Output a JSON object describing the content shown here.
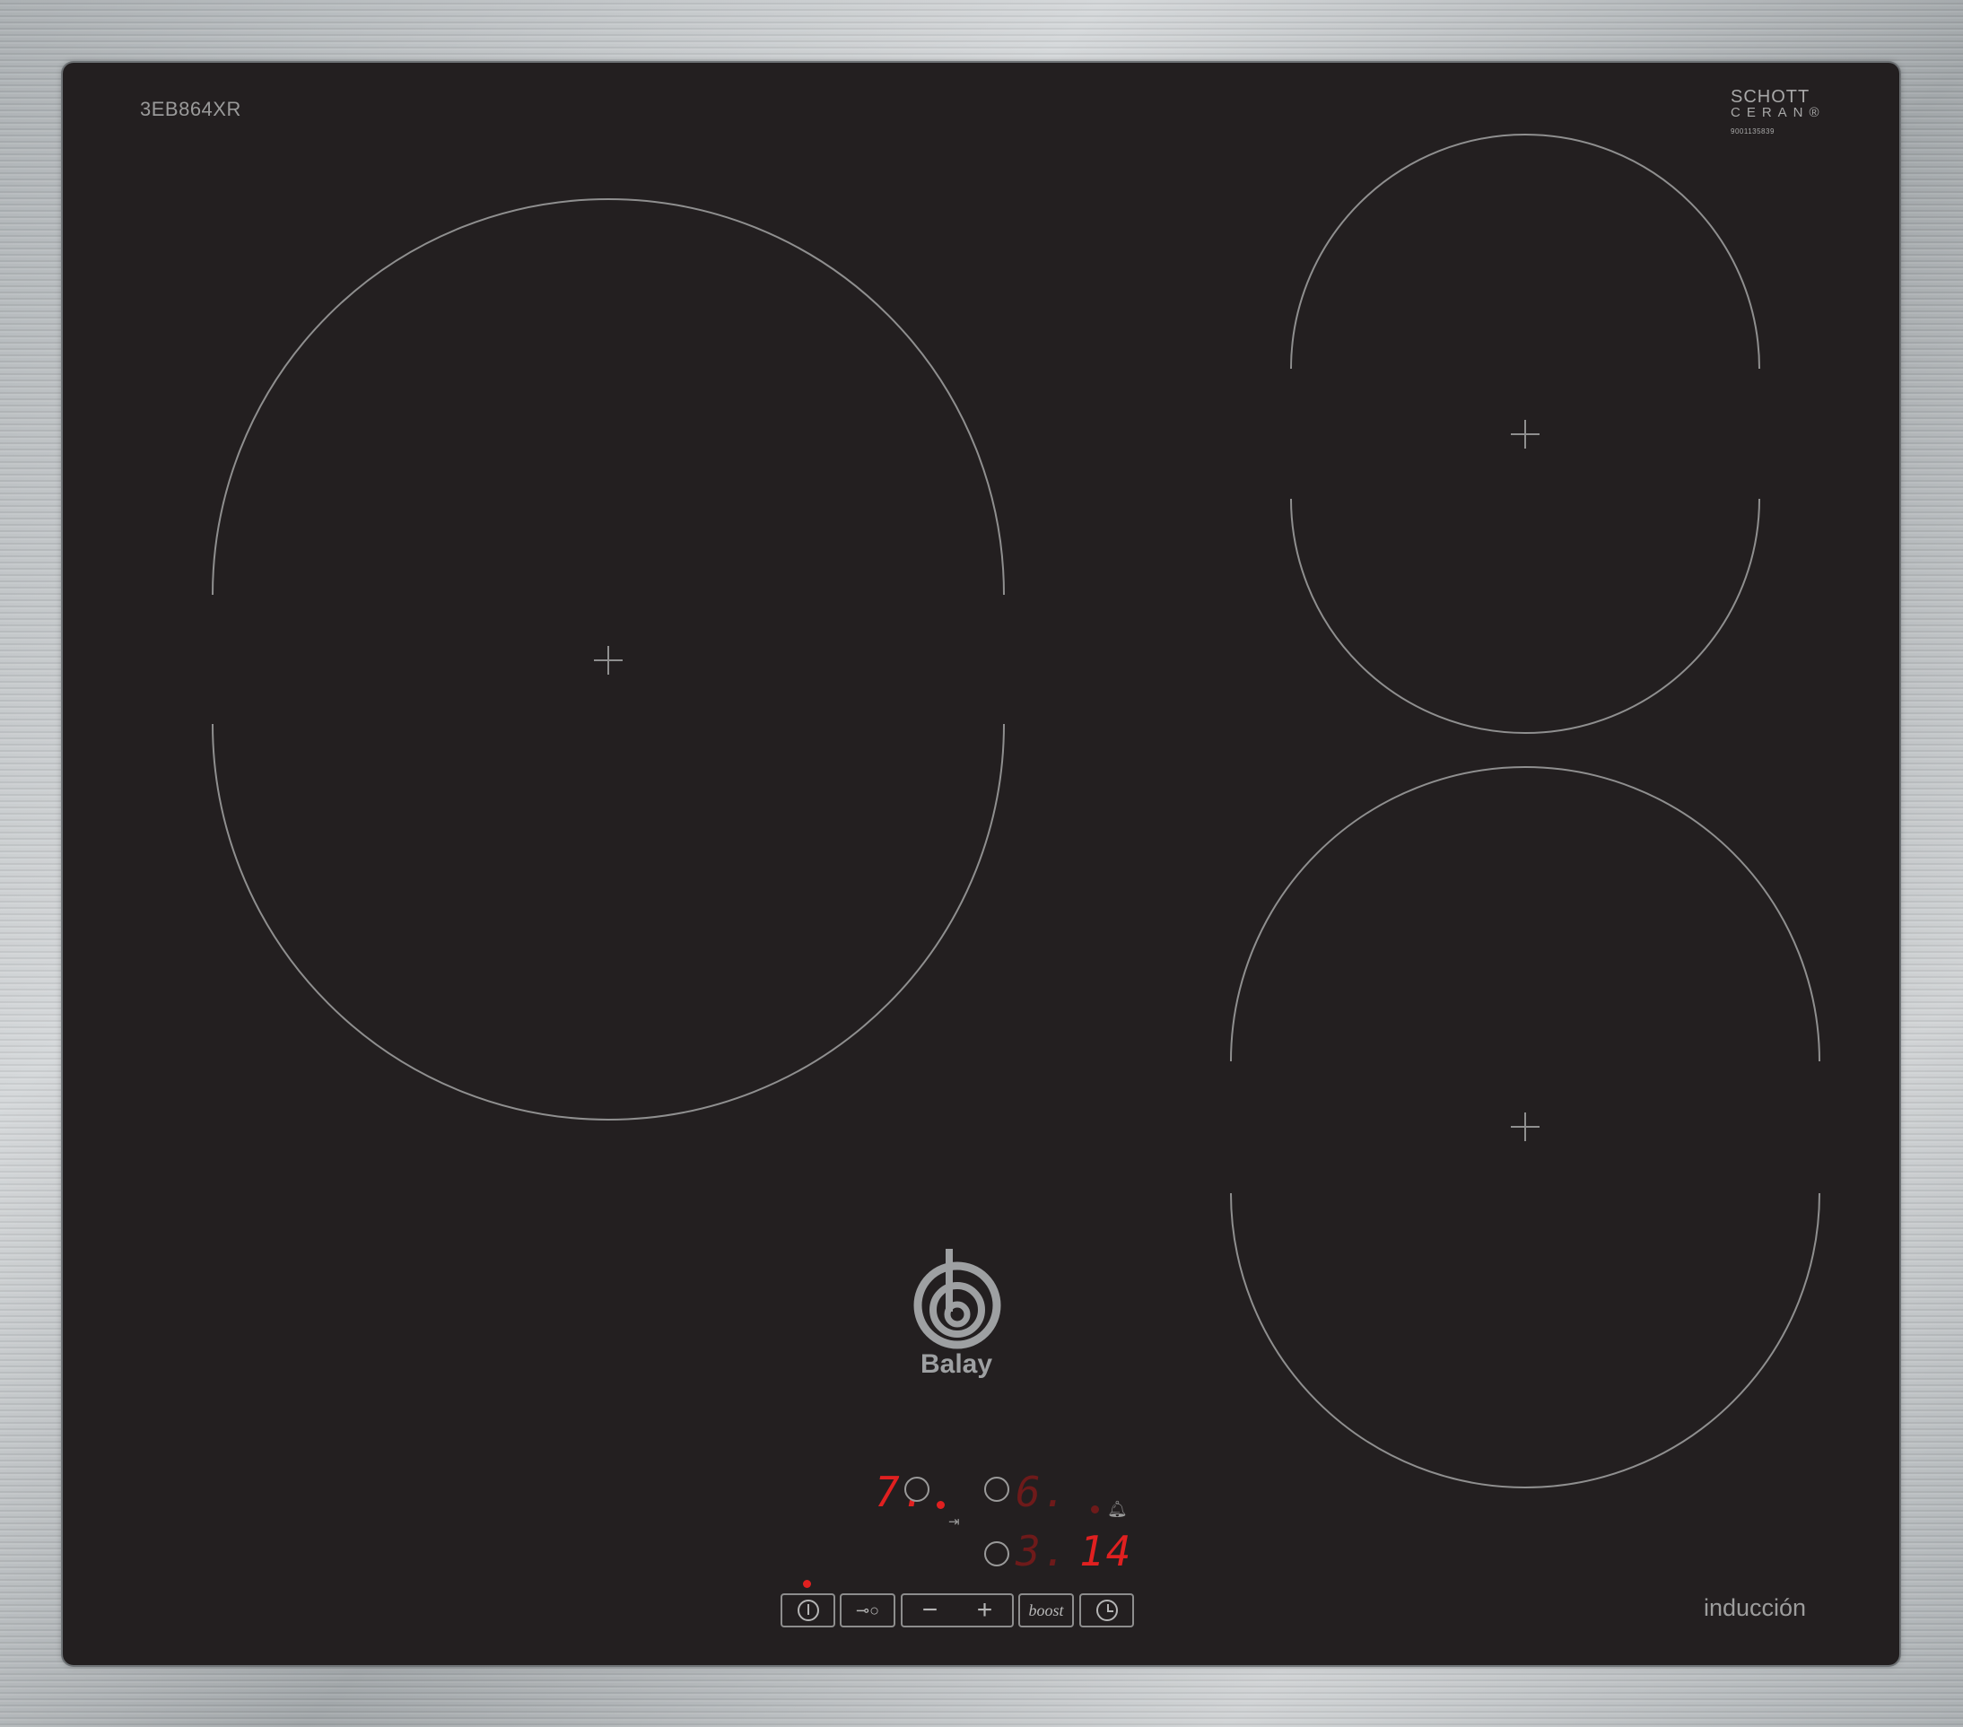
{
  "appliance": {
    "model": "3EB864XR",
    "glass_brand_line1": "SCHOTT",
    "glass_brand_line2": "CERAN®",
    "glass_code": "9001135839",
    "brand": "Balay",
    "type_label": "inducción"
  },
  "display": {
    "left_level": "7.",
    "right_top_level": "6.",
    "right_bottom_level": "3.",
    "timer": "14"
  },
  "controls": {
    "power_icon": "power-icon",
    "lock_icon": "key-lock-icon",
    "minus_label": "−",
    "plus_label": "+",
    "boost_label": "boost",
    "timer_icon": "clock-icon",
    "bell_icon": "bell-icon",
    "zone_link_icon": "zone-link-icon"
  },
  "colors": {
    "glass": "#231f20",
    "led_red": "#e02020",
    "frame": "#b8bcbf"
  }
}
